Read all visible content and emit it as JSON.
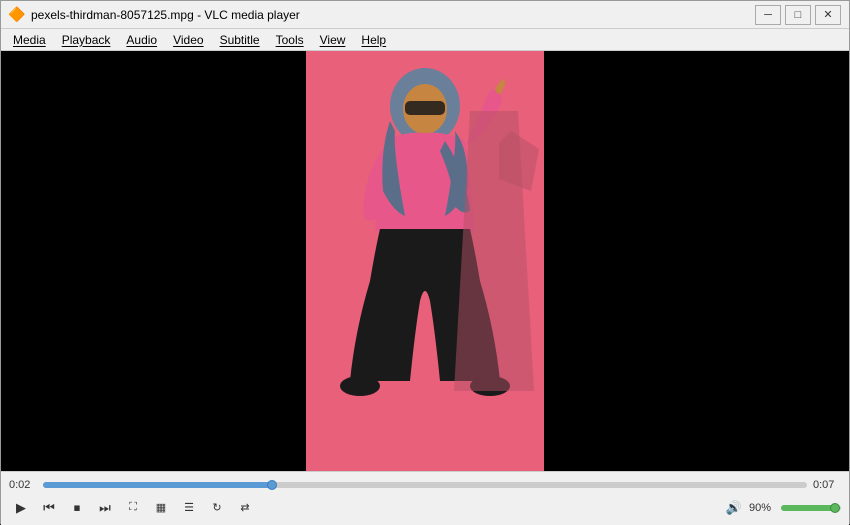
{
  "titlebar": {
    "icon": "🔶",
    "title": "pexels-thirdman-8057125.mpg - VLC media player",
    "minimize": "─",
    "maximize": "□",
    "close": "✕"
  },
  "menubar": {
    "items": [
      {
        "label": "Media",
        "id": "menu-media"
      },
      {
        "label": "Playback",
        "id": "menu-playback"
      },
      {
        "label": "Audio",
        "id": "menu-audio"
      },
      {
        "label": "Video",
        "id": "menu-video"
      },
      {
        "label": "Subtitle",
        "id": "menu-subtitle"
      },
      {
        "label": "Tools",
        "id": "menu-tools"
      },
      {
        "label": "View",
        "id": "menu-view"
      },
      {
        "label": "Help",
        "id": "menu-help"
      }
    ]
  },
  "player": {
    "time_current": "0:02",
    "time_total": "0:07",
    "progress_pct": 30,
    "volume_pct": "90%",
    "volume_level": 90
  },
  "controls": {
    "play": "▶",
    "prev": "⏮",
    "stop": "⏹",
    "next": "⏭",
    "fullscreen": "⛶",
    "extended": "⧉",
    "playlist": "☰",
    "loop": "↻",
    "random": "⇄"
  }
}
